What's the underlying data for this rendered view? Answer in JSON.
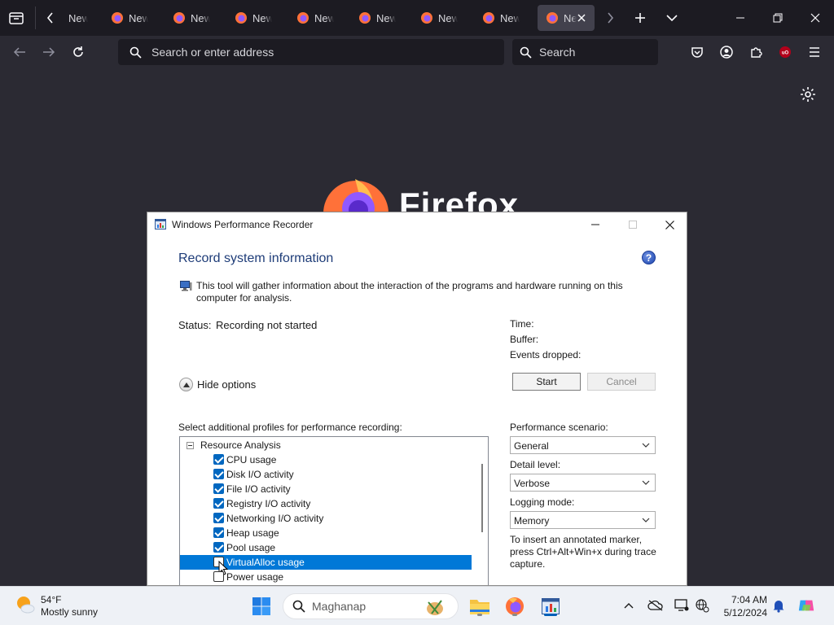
{
  "browser": {
    "tabs": [
      {
        "label": "New Tab"
      },
      {
        "label": "New Tab"
      },
      {
        "label": "New Tab"
      },
      {
        "label": "New Tab"
      },
      {
        "label": "New Tab"
      },
      {
        "label": "New Tab"
      },
      {
        "label": "New Tab"
      },
      {
        "label": "New Tab"
      },
      {
        "label": "New Tab",
        "active": true
      }
    ],
    "url_placeholder": "Search or enter address",
    "search_placeholder": "Search",
    "newtab_brand": "Firefox"
  },
  "dialog": {
    "title": "Windows Performance Recorder",
    "heading": "Record system information",
    "help_label": "?",
    "info_text": "This tool will gather information about the interaction of the programs and hardware running on this computer for analysis.",
    "status_label": "Status:",
    "status_value": "Recording not started",
    "time_label": "Time:",
    "buffer_label": "Buffer:",
    "events_dropped_label": "Events dropped:",
    "start_label": "Start",
    "cancel_label": "Cancel",
    "hide_options_label": "Hide options",
    "profiles_label": "Select additional profiles for performance recording:",
    "profile_group": "Resource Analysis",
    "profiles": [
      {
        "label": "CPU usage",
        "checked": true
      },
      {
        "label": "Disk I/O activity",
        "checked": true
      },
      {
        "label": "File I/O activity",
        "checked": true
      },
      {
        "label": "Registry I/O activity",
        "checked": true
      },
      {
        "label": "Networking I/O activity",
        "checked": true
      },
      {
        "label": "Heap usage",
        "checked": true
      },
      {
        "label": "Pool usage",
        "checked": true
      },
      {
        "label": "VirtualAlloc usage",
        "checked": false,
        "selected": true
      },
      {
        "label": "Power usage",
        "checked": false
      }
    ],
    "scenario_label": "Performance scenario:",
    "scenario_value": "General",
    "detail_label": "Detail level:",
    "detail_value": "Verbose",
    "logging_label": "Logging mode:",
    "logging_value": "Memory",
    "marker_note": "To insert an annotated marker, press Ctrl+Alt+Win+x during trace capture."
  },
  "taskbar": {
    "temperature": "54°F",
    "weather_desc": "Mostly sunny",
    "search_text": "Maghanap",
    "time": "7:04 AM",
    "date": "5/12/2024"
  },
  "colors": {
    "accent": "#0078d7",
    "checkbox": "#0067c0",
    "heading": "#1e3c78",
    "browser_bg": "#1c1b22",
    "toolbar_bg": "#2b2a33"
  }
}
